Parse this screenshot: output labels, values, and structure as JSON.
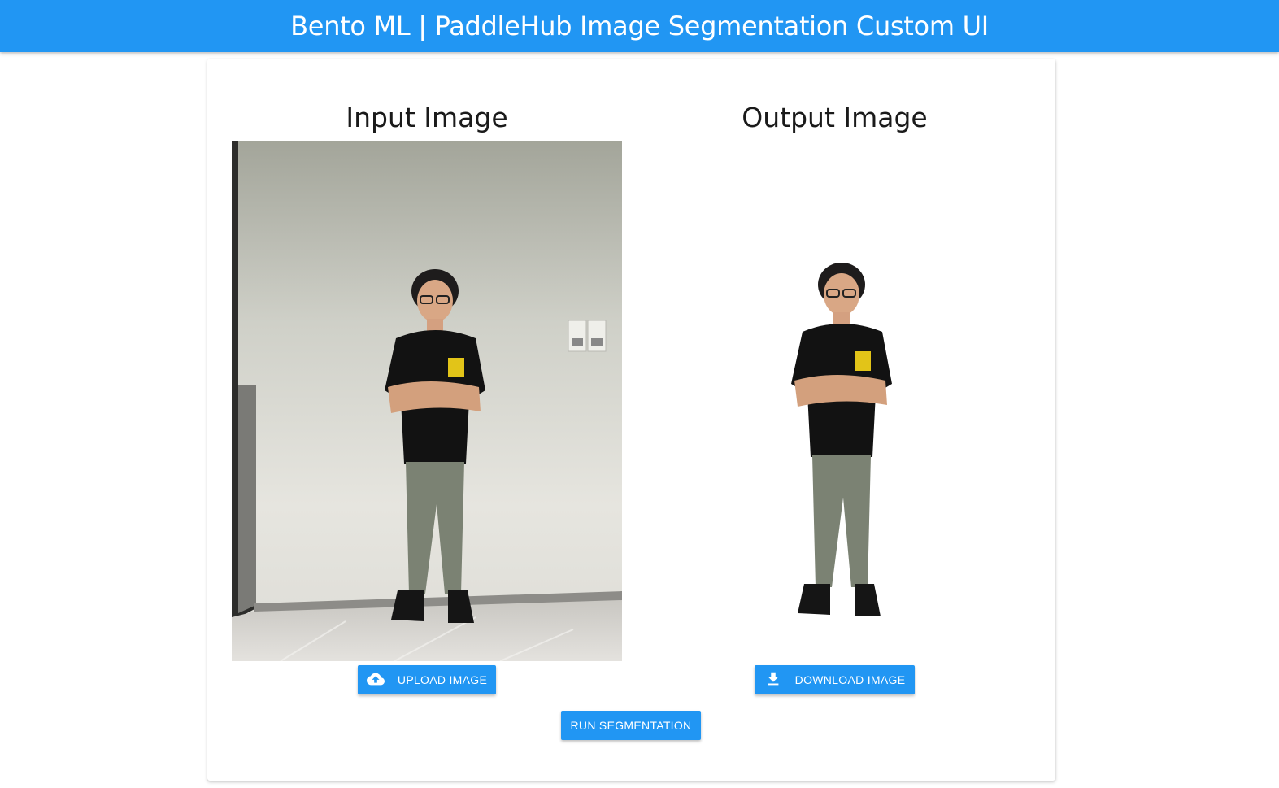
{
  "header": {
    "title": "Bento ML | PaddleHub Image Segmentation Custom UI"
  },
  "input": {
    "title": "Input Image",
    "upload_label": "UPLOAD IMAGE"
  },
  "output": {
    "title": "Output Image",
    "download_label": "DOWNLOAD IMAGE"
  },
  "actions": {
    "run_label": "RUN SEGMENTATION"
  },
  "icons": {
    "upload": "cloud-upload-icon",
    "download": "download-icon"
  },
  "colors": {
    "primary": "#2196f3"
  }
}
